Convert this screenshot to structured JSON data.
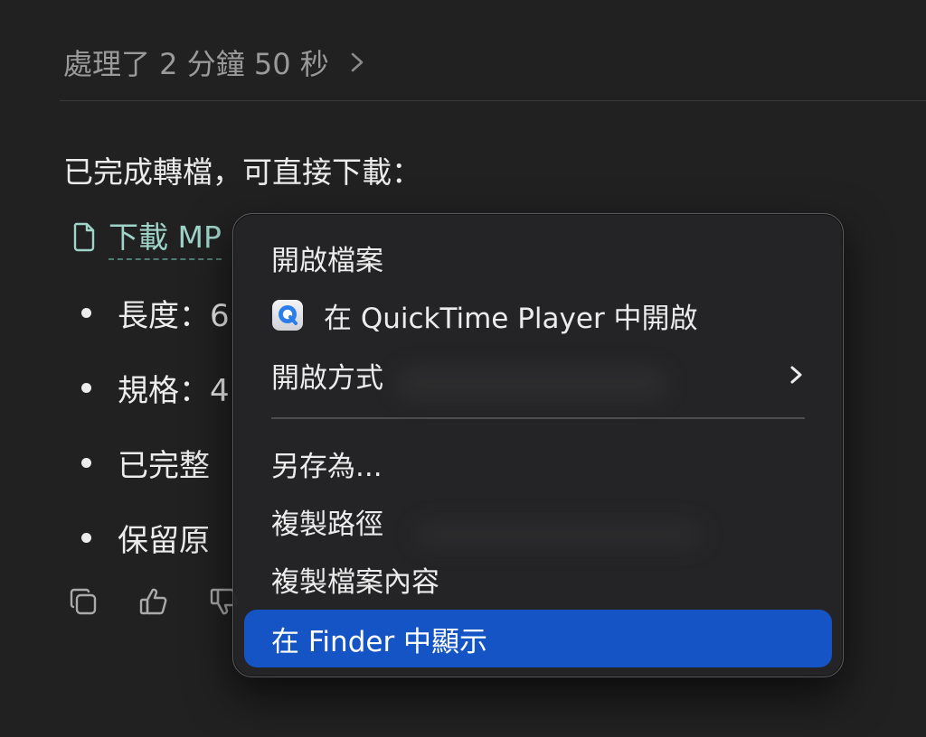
{
  "thinking": {
    "label": "處理了 2 分鐘 50 秒",
    "chevron_icon": "chevron-right-icon"
  },
  "message": {
    "intro": "已完成轉檔，可直接下載：",
    "download_link": "下載 MP",
    "bullets": [
      "長度：6",
      "規格：4",
      "已完整",
      "保留原"
    ]
  },
  "actions": [
    {
      "name": "copy",
      "icon": "copy-icon"
    },
    {
      "name": "thumbs-up",
      "icon": "thumbs-up-icon"
    },
    {
      "name": "thumbs-down",
      "icon": "thumbs-down-icon"
    }
  ],
  "context_menu": {
    "items": [
      {
        "label": "開啟檔案"
      },
      {
        "label": "在 QuickTime Player 中開啟",
        "icon": "quicktime-icon"
      },
      {
        "label": "開啟方式",
        "submenu": true
      },
      {
        "label": "另存為..."
      },
      {
        "label": "複製路徑"
      },
      {
        "label": "複製檔案內容"
      },
      {
        "label": "在 Finder 中顯示",
        "selected": true
      }
    ]
  },
  "colors": {
    "background": "#212121",
    "menu_background": "#242426",
    "selected_item": "#1554c4",
    "link": "#9fd5c9",
    "muted_text": "#9a9a9a"
  }
}
